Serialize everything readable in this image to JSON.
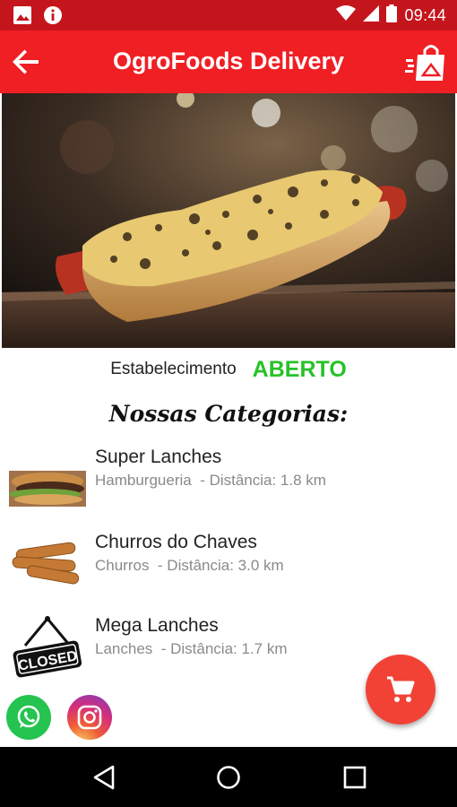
{
  "status_bar": {
    "time": "09:44",
    "icons": [
      "image-icon",
      "info-icon",
      "wifi-icon",
      "signal-icon",
      "battery-icon"
    ]
  },
  "app_bar": {
    "title": "OgroFoods Delivery",
    "icons": [
      "back-arrow-icon",
      "shopping-bag-icon"
    ]
  },
  "hero": {
    "image": "hot-dog-with-cheese"
  },
  "establishment": {
    "label": "Estabelecimento",
    "status": "ABERTO",
    "status_color": "#27c227"
  },
  "categories_title": "Nossas Categorias:",
  "categories": [
    {
      "name": "Super Lanches",
      "type": "Hamburgueria",
      "distance": "- Distância: 1.8 km",
      "thumb": "burger-photo"
    },
    {
      "name": "Churros do Chaves",
      "type": "Churros",
      "distance": "- Distância: 3.0 km",
      "thumb": "churros-photo"
    },
    {
      "name": "Mega Lanches",
      "type": "Lanches",
      "distance": "- Distância: 1.7 km",
      "thumb": "closed-sign"
    }
  ],
  "colors": {
    "status_bar": "#c4151c",
    "app_bar": "#ef1f24",
    "fab": "#f24236"
  },
  "fab": {
    "icon": "cart-icon"
  },
  "social": [
    "whatsapp-icon",
    "instagram-icon"
  ],
  "nav": [
    "back-nav-icon",
    "home-nav-icon",
    "recents-nav-icon"
  ]
}
